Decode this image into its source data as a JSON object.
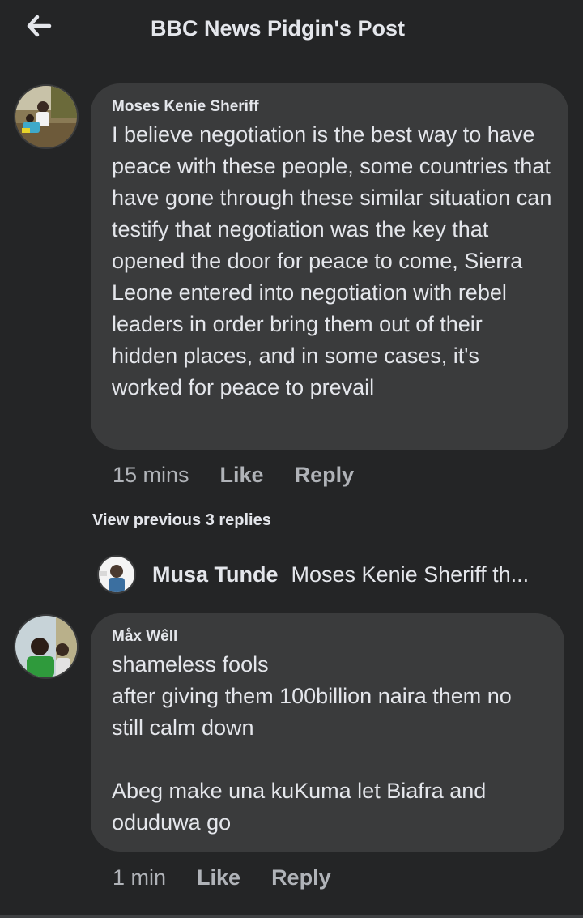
{
  "header": {
    "title": "BBC News Pidgin's Post",
    "back_icon": "arrow-left-icon"
  },
  "comments": [
    {
      "author": "Moses Kenie Sheriff",
      "text": "I believe negotiation is the best way to have peace with these people, some countries that have gone through these similar situation can testify that negotiation was the key that opened the door for peace to come, Sierra Leone entered into negotiation with rebel leaders in order bring them out of their hidden places, and in some cases, it's worked for peace to prevail",
      "time": "15 mins",
      "like_label": "Like",
      "reply_label": "Reply"
    },
    {
      "author": "Måx Wêll",
      "text": "shameless fools\nafter giving them 100billion naira them no still calm down\n\nAbeg make una kuKuma let Biafra and oduduwa go",
      "time": "1 min",
      "like_label": "Like",
      "reply_label": "Reply"
    }
  ],
  "replies_thread": {
    "view_previous_label": "View previous 3 replies",
    "preview_author": "Musa Tunde",
    "preview_snippet": "Moses Kenie Sheriff th..."
  },
  "colors": {
    "background": "#242526",
    "bubble": "#3a3b3c",
    "text_primary": "#e4e6eb",
    "text_secondary": "#b0b3b8"
  }
}
